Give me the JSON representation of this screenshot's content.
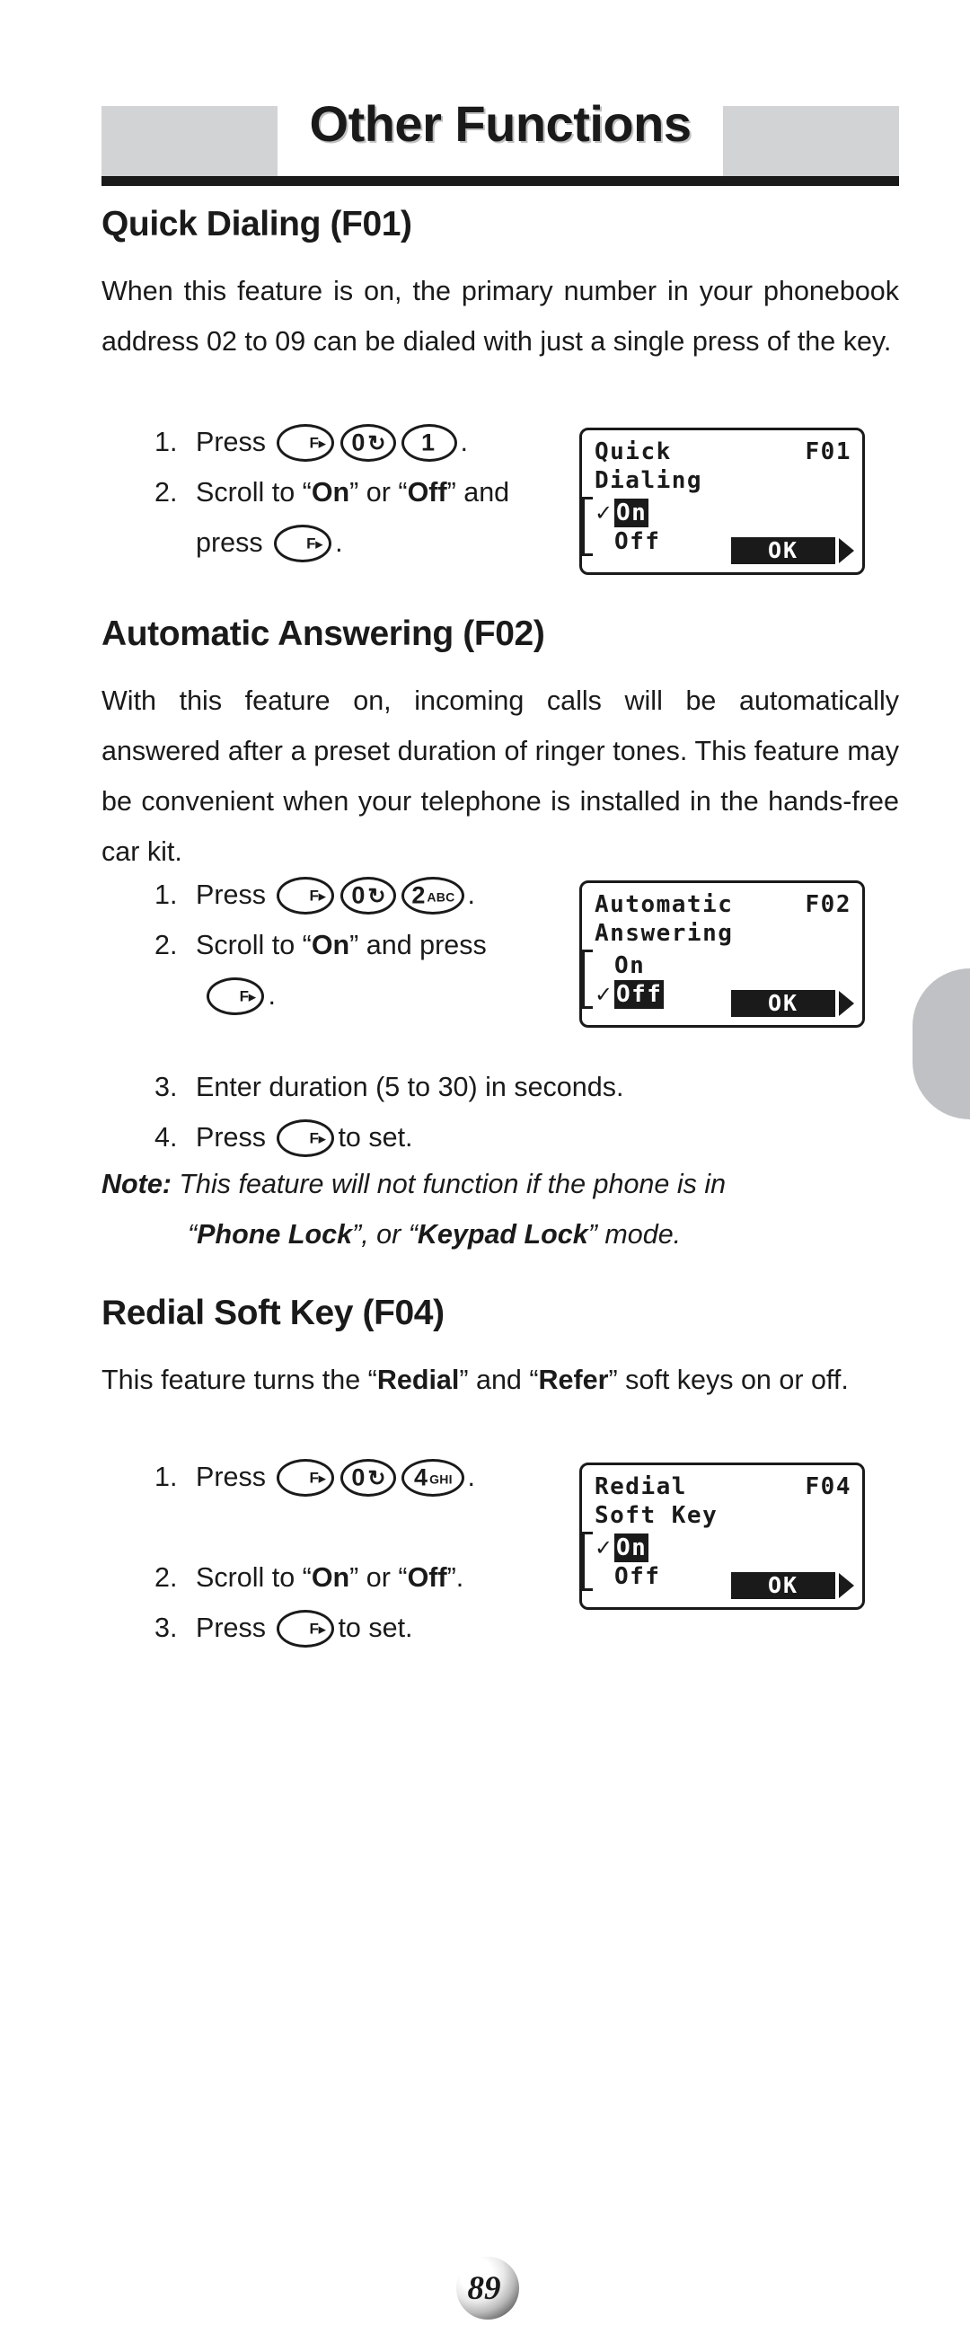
{
  "header": {
    "title": "Other Functions"
  },
  "sections": [
    {
      "heading": "Quick Dialing (F01)",
      "body": "When this feature is on, the primary number in your phonebook address 02 to 09 can be dialed with just a single press of the key.",
      "steps": [
        {
          "num": "1.",
          "lead": "Press",
          "keys": [
            "F▸",
            "0 ↺",
            "1"
          ],
          "tail": "."
        },
        {
          "num": "2.",
          "text_a": "Scroll to “",
          "bold_a": "On",
          "text_b": "” or “",
          "bold_b": "Off",
          "text_c": "” and",
          "line2_lead": "press",
          "line2_key": "F▸",
          "line2_tail": "."
        }
      ],
      "lcd": {
        "title_line1": "Quick",
        "title_line2": "Dialing",
        "code": "F01",
        "options": [
          {
            "label": "On",
            "checked": true,
            "selected": true
          },
          {
            "label": "Off",
            "checked": false,
            "selected": false
          }
        ],
        "ok_label": "OK"
      }
    },
    {
      "heading": "Automatic Answering (F02)",
      "body": "With this feature on, incoming calls will be automatically answered after a preset duration of ringer tones. This feature may be convenient when your telephone is installed in the hands-free car kit.",
      "steps": [
        {
          "num": "1.",
          "lead": "Press",
          "keys": [
            "F▸",
            "0 ↺",
            "2 ABC"
          ],
          "tail": "."
        },
        {
          "num": "2.",
          "text_a": "Scroll to “",
          "bold_a": "On",
          "text_b": "” and press",
          "line2_key": "F▸",
          "line2_tail": "."
        },
        {
          "num": "3.",
          "plain": "Enter duration (5 to 30) in seconds."
        },
        {
          "num": "4.",
          "lead": "Press",
          "keys": [
            "F▸"
          ],
          "tail": "to set."
        }
      ],
      "note": {
        "label": "Note:",
        "line1": "This feature will not function if the phone is in",
        "line2_pre": "“",
        "line2_bold_a": "Phone Lock",
        "line2_mid": "”, or “",
        "line2_bold_b": "Keypad Lock",
        "line2_post": "” mode."
      },
      "lcd": {
        "title_line1": "Automatic",
        "title_line2": "Answering",
        "code": "F02",
        "options": [
          {
            "label": "On",
            "checked": false,
            "selected": false
          },
          {
            "label": "Off",
            "checked": true,
            "selected": true
          }
        ],
        "ok_label": "OK"
      }
    },
    {
      "heading": "Redial Soft Key (F04)",
      "body_a": "This feature turns the “",
      "body_bold_a": "Redial",
      "body_b": "” and “",
      "body_bold_b": "Refer",
      "body_c": "” soft keys on or off.",
      "steps": [
        {
          "num": "1.",
          "lead": "Press",
          "keys": [
            "F▸",
            "0 ↺",
            "4 GHI"
          ],
          "tail": "."
        },
        {
          "num": "2.",
          "text_a": "Scroll to “",
          "bold_a": "On",
          "text_b": "” or “",
          "bold_b": "Off",
          "text_c": "”."
        },
        {
          "num": "3.",
          "lead": "Press",
          "keys": [
            "F▸"
          ],
          "tail": "to set."
        }
      ],
      "lcd": {
        "title_line1": "Redial",
        "title_line2": "Soft Key",
        "code": "F04",
        "options": [
          {
            "label": "On",
            "checked": true,
            "selected": true
          },
          {
            "label": "Off",
            "checked": false,
            "selected": false
          }
        ],
        "ok_label": "OK"
      }
    }
  ],
  "page_number": "89",
  "colors": {
    "ink": "#1a1a1a",
    "header_block": "#d2d3d5",
    "edge_tab": "#c0c1c4"
  },
  "keys": {
    "function_key": "F▸",
    "zero_loop": "0 ↺",
    "one": "1",
    "two_abc": "2 ABC",
    "four_ghi": "4 GHI"
  },
  "checkmark": "✓"
}
